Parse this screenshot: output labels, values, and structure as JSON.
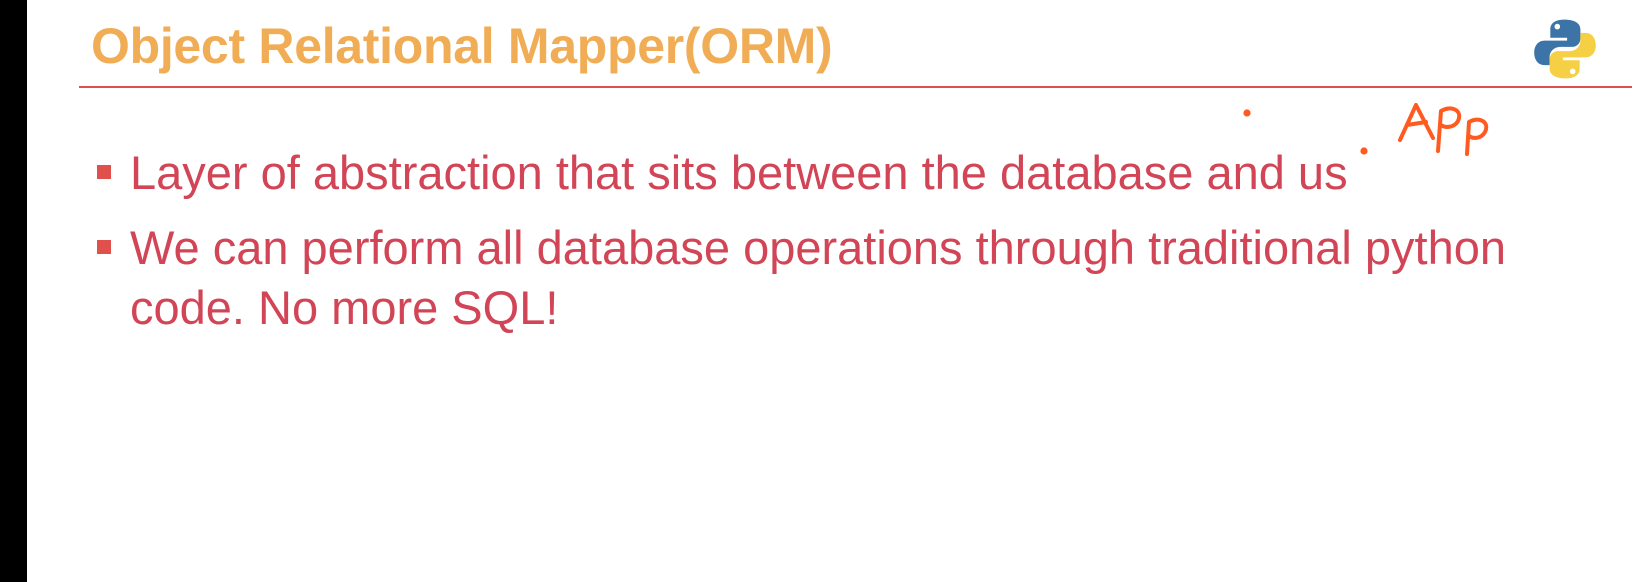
{
  "slide": {
    "title": "Object Relational Mapper(ORM)",
    "bullets": [
      {
        "text": "Layer of abstraction that sits between the database and us"
      },
      {
        "text": "We can perform all database operations through traditional python code. No more SQL!"
      }
    ]
  },
  "annotation": {
    "text": "APP"
  },
  "logo": {
    "icon": "python-logo-icon"
  },
  "colors": {
    "title": "#f0ad55",
    "rule": "#e0504d",
    "bullet_text": "#d24556",
    "bullet_marker": "#e0504d",
    "annotation_ink": "#ff5a1f",
    "side_bar": "#000000",
    "python_blue": "#3d74a8",
    "python_yellow": "#f6d044"
  }
}
